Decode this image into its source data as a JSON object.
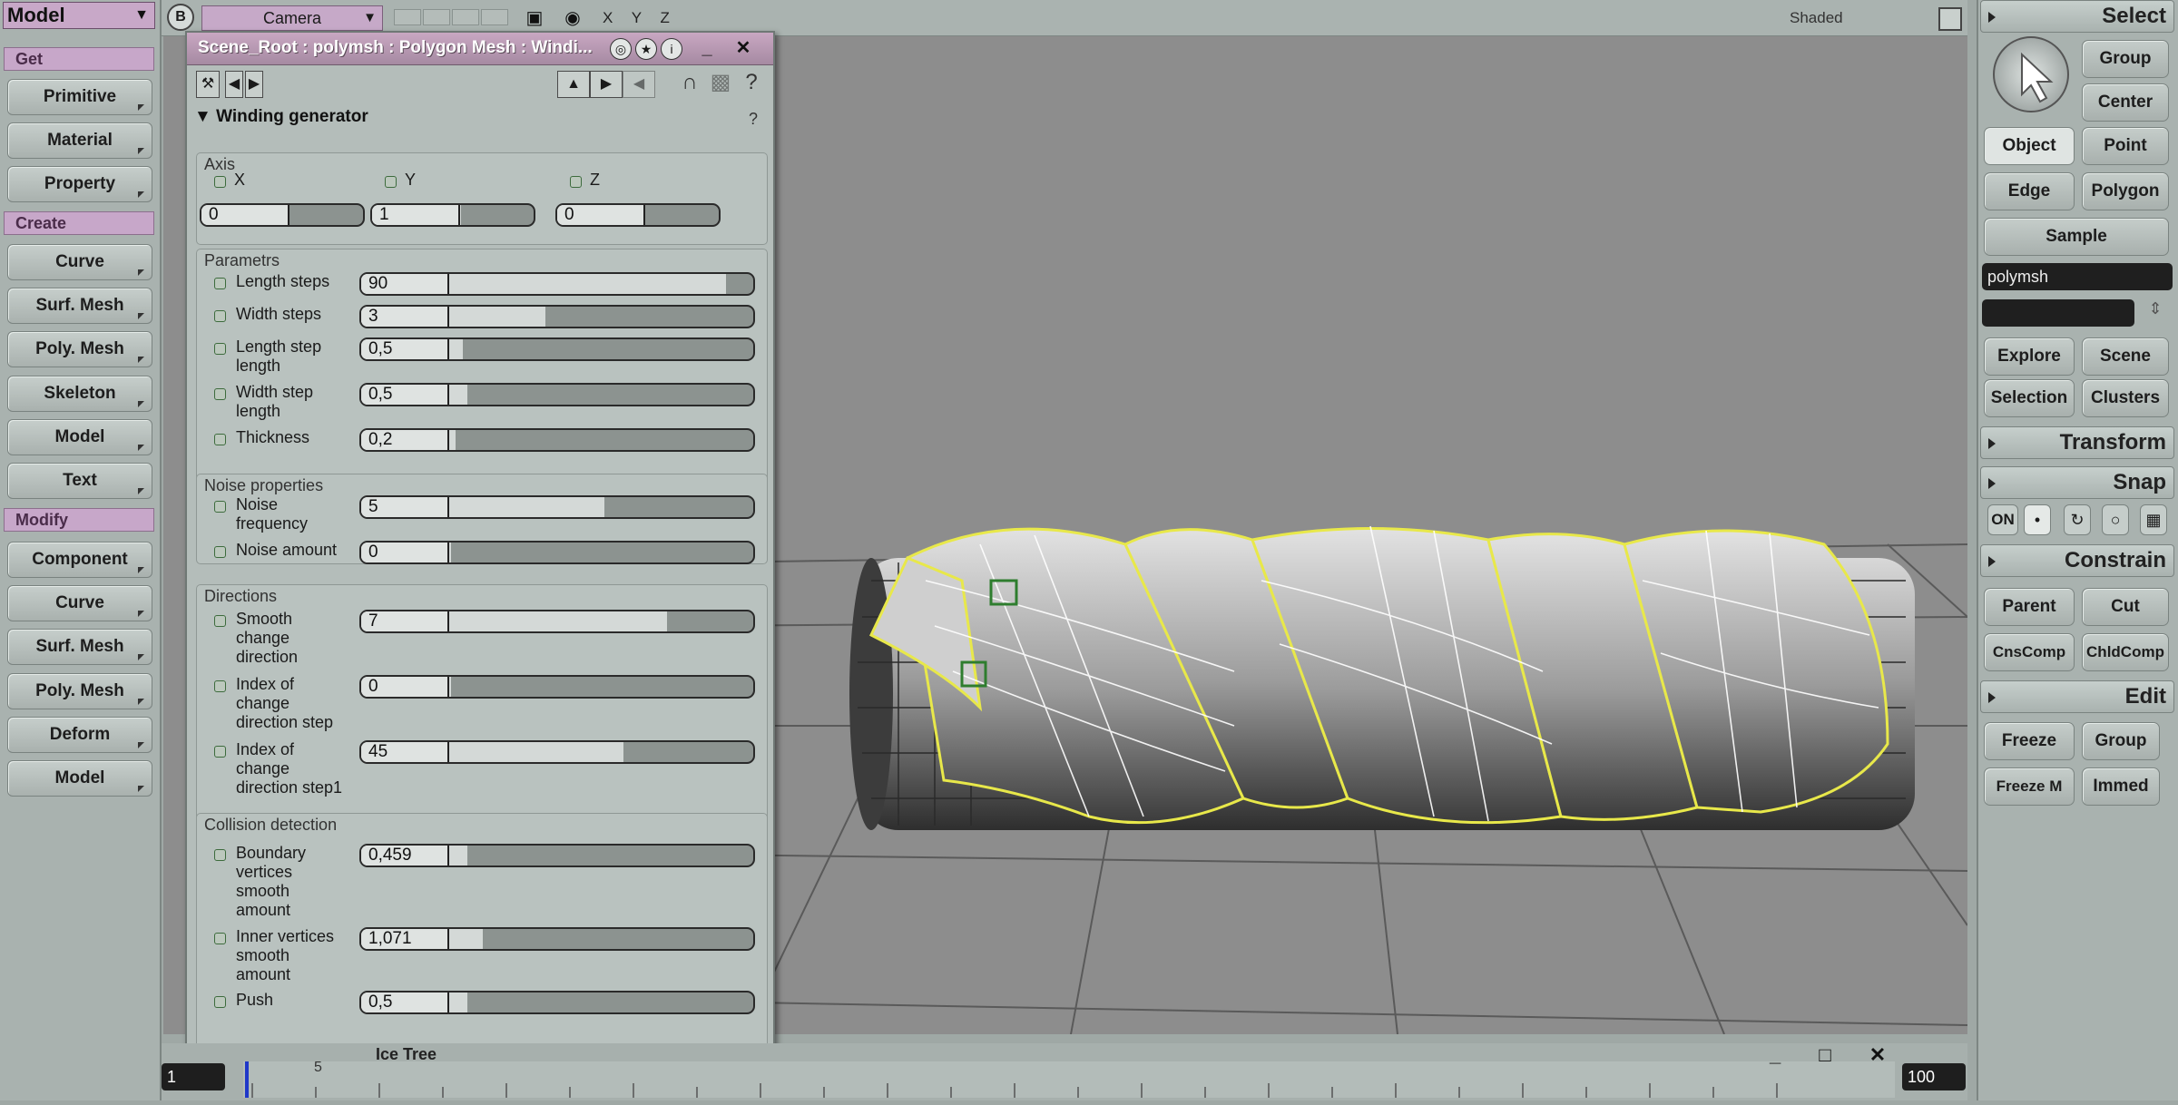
{
  "left_palette": {
    "mode": "Model",
    "sections": {
      "get": "Get",
      "create": "Create",
      "modify": "Modify"
    },
    "get_buttons": [
      "Primitive",
      "Material",
      "Property"
    ],
    "create_buttons": [
      "Curve",
      "Surf. Mesh",
      "Poly. Mesh",
      "Skeleton",
      "Model",
      "Text"
    ],
    "modify_buttons": [
      "Component",
      "Curve",
      "Surf. Mesh",
      "Poly. Mesh",
      "Deform",
      "Model"
    ]
  },
  "top_bar": {
    "view_letter": "B",
    "camera": "Camera",
    "axes": "X Y Z",
    "display_mode": "Shaded"
  },
  "dialog": {
    "title": "Scene_Root : polymsh : Polygon Mesh : Windi...",
    "property": "Winding generator",
    "axis": {
      "label": "Axis",
      "items": [
        {
          "label": "X",
          "value": "0",
          "fill": 0.45
        },
        {
          "label": "Y",
          "value": "1",
          "fill": 0.55
        },
        {
          "label": "Z",
          "value": "0",
          "fill": 0.5
        }
      ]
    },
    "parameters": {
      "label": "Parametrs",
      "items": [
        {
          "label": "Length steps",
          "value": "90",
          "fill": 0.93
        },
        {
          "label": "Width steps",
          "value": "3",
          "fill": 0.47
        },
        {
          "label": "Length step length",
          "value": "0,5",
          "fill": 0.26
        },
        {
          "label": "Width step length",
          "value": "0,5",
          "fill": 0.27
        },
        {
          "label": "Thickness",
          "value": "0,2",
          "fill": 0.24
        }
      ]
    },
    "noise": {
      "label": "Noise properties",
      "items": [
        {
          "label": "Noise frequency",
          "value": "5",
          "fill": 0.62
        },
        {
          "label": "Noise amount",
          "value": "0",
          "fill": 0.23
        }
      ]
    },
    "directions": {
      "label": "Directions",
      "items": [
        {
          "label": "Smooth change direction",
          "value": "7",
          "fill": 0.78
        },
        {
          "label": "Index of change direction step",
          "value": "0",
          "fill": 0.23
        },
        {
          "label": "Index of change direction step1",
          "value": "45",
          "fill": 0.67
        }
      ]
    },
    "collision": {
      "label": "Collision detection",
      "items": [
        {
          "label": "Boundary vertices smooth amount",
          "value": "0,459",
          "fill": 0.27
        },
        {
          "label": "Inner vertices smooth amount",
          "value": "1,071",
          "fill": 0.31
        },
        {
          "label": "Push",
          "value": "0,5",
          "fill": 0.27
        }
      ]
    }
  },
  "right_palette": {
    "select_header": "Select",
    "select_buttons": [
      "Group",
      "Center",
      "Object",
      "Point",
      "Edge",
      "Polygon",
      "Sample"
    ],
    "object_name": "polymsh",
    "explore_buttons": [
      "Explore",
      "Scene",
      "Selection",
      "Clusters"
    ],
    "transform_header": "Transform",
    "snap_header": "Snap",
    "snap_on": "ON",
    "constrain_header": "Constrain",
    "constrain_buttons": [
      "Parent",
      "Cut",
      "CnsComp",
      "ChldComp"
    ],
    "edit_header": "Edit",
    "edit_buttons": [
      "Freeze",
      "Group",
      "Freeze M",
      "Immed"
    ]
  },
  "timeline": {
    "start_frame": "1",
    "end_frame": "100",
    "tick_label": "5",
    "bottom_label": "Ice Tree"
  },
  "colors": {
    "accent_mauve": "#c8a8c8",
    "viewport_bg": "#8d8d8d",
    "selection_yellow": "#e8e84a"
  }
}
